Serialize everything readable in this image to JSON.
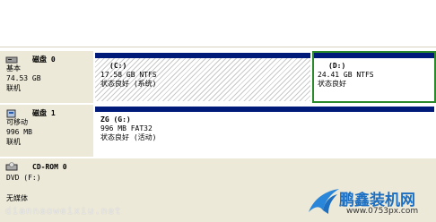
{
  "disks": [
    {
      "name": "磁盘 0",
      "type": "基本",
      "size": "74.53 GB",
      "status": "联机",
      "partitions": [
        {
          "label": "(C:)",
          "size_fs": "17.58 GB NTFS",
          "status": "状态良好 (系统)"
        },
        {
          "label": "(D:)",
          "size_fs": "24.41 GB NTFS",
          "status": "状态良好"
        }
      ]
    },
    {
      "name": "磁盘 1",
      "type": "可移动",
      "size": "996 MB",
      "status": "联机",
      "partitions": [
        {
          "label": "ZG  (G:)",
          "size_fs": "996 MB FAT32",
          "status": "状态良好 (活动)"
        }
      ]
    },
    {
      "name": "CD-ROM 0",
      "type": "DVD (F:)",
      "media": "无媒体"
    }
  ],
  "watermark": "diannaoweixiu.net",
  "brand": {
    "name": "鹏鑫装机网",
    "url": "www.0753px.com"
  },
  "colors": {
    "partition_bar": "#001a7a",
    "selected_outline": "#2c8a2c",
    "panel_bg": "#ece9d8"
  }
}
